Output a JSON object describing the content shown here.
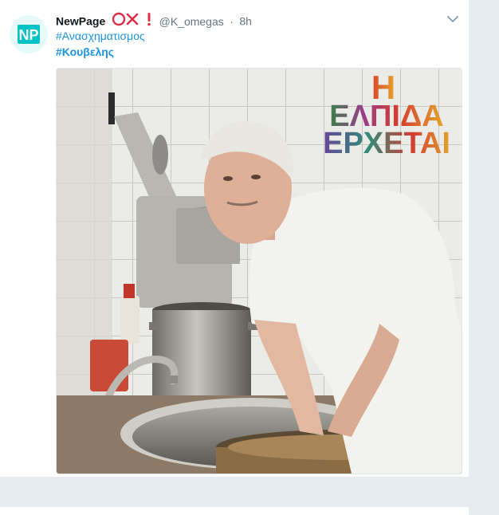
{
  "tweet": {
    "display_name": "NewPage",
    "handle": "@K_omegas",
    "separator": "·",
    "time": "8h",
    "hashtags": [
      "#Ανασχηματισμος",
      "#Κουβελης"
    ],
    "avatar_text": "NP",
    "emoji": [
      "cross-mark",
      "exclamation-mark"
    ]
  },
  "media": {
    "overlay_lines": [
      "Η",
      "ΕΛΠΙΔΑ",
      "ΕΡΧΕΤΑΙ"
    ]
  },
  "colors": {
    "link": "#1b95e0",
    "emoji_red": "#dd2e44",
    "page_bg": "#e6ecf0"
  }
}
